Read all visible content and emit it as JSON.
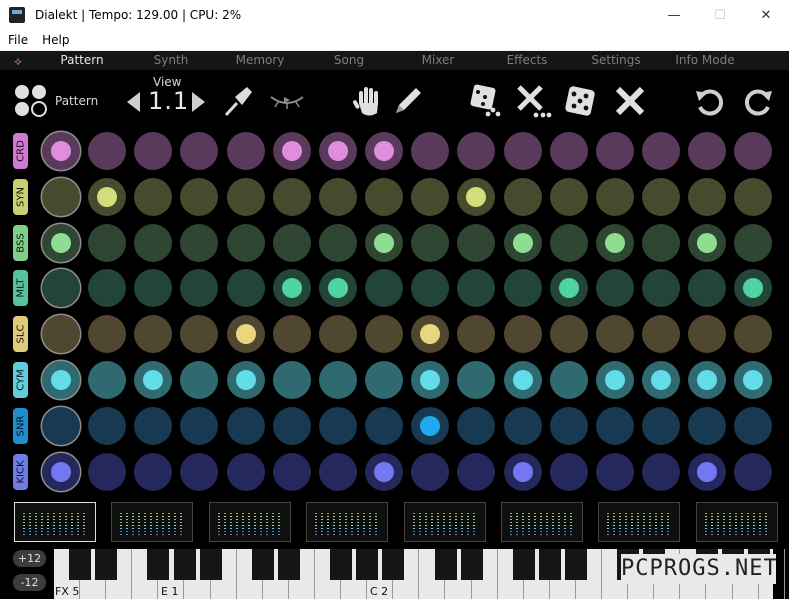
{
  "window": {
    "title": "Dialekt | Tempo: 129.00 | CPU: 2%",
    "controls": [
      "—",
      "☐",
      "✕"
    ]
  },
  "menu": [
    "File",
    "Help"
  ],
  "tabs": [
    "Pattern",
    "Synth",
    "Memory",
    "Song",
    "Mixer",
    "Effects",
    "Settings",
    "Info Mode"
  ],
  "active_tab": 0,
  "toolbar": {
    "pattern_label": "Pattern",
    "view_label": "View",
    "view_value": "1.1"
  },
  "tracks": [
    {
      "label": "CRD",
      "base": "#5a3a5a",
      "label_bg": "#d07ad0",
      "active": "#e08de0",
      "on": [
        0,
        5,
        6,
        7
      ]
    },
    {
      "label": "SYN",
      "base": "#474b2e",
      "label_bg": "#c9d070",
      "active": "#d4dc7c",
      "on": [
        1,
        9
      ]
    },
    {
      "label": "BSS",
      "base": "#2f4632",
      "label_bg": "#7fcf85",
      "active": "#8fdd90",
      "on": [
        0,
        7,
        10,
        12,
        14
      ]
    },
    {
      "label": "MLT",
      "base": "#224538",
      "label_bg": "#55c49d",
      "active": "#4fd3a2",
      "on": [
        5,
        6,
        11,
        15
      ]
    },
    {
      "label": "SLC",
      "base": "#4f4730",
      "label_bg": "#e0cb7a",
      "active": "#ecd57f",
      "on": [
        4,
        8
      ]
    },
    {
      "label": "CYM",
      "base": "#2f6a70",
      "label_bg": "#5fcfe0",
      "active": "#63dcea",
      "on": [
        0,
        2,
        4,
        8,
        10,
        12,
        13,
        14,
        15
      ]
    },
    {
      "label": "SNR",
      "base": "#173a52",
      "label_bg": "#1f8ed0",
      "active": "#1fa8f0",
      "on": [
        8
      ]
    },
    {
      "label": "KICK",
      "base": "#25285c",
      "label_bg": "#6f7ce6",
      "active": "#7378f2",
      "on": [
        0,
        7,
        10,
        14
      ]
    }
  ],
  "octave": {
    "up": "+12",
    "down": "-12"
  },
  "keyboard_labels": [
    "FX 5",
    "E 1",
    "C 2"
  ],
  "watermark": "PCPROGS.NET"
}
